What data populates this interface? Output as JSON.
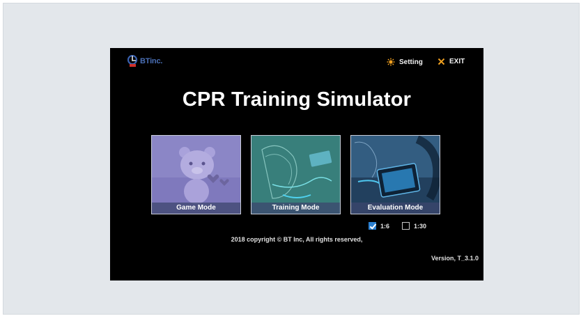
{
  "brand": {
    "logo_text": "BTinc."
  },
  "header": {
    "setting_label": "Setting",
    "exit_label": "EXIT"
  },
  "app_title": "CPR Training Simulator",
  "modes": [
    {
      "label": "Game Mode"
    },
    {
      "label": "Training Mode"
    },
    {
      "label": "Evaluation Mode"
    }
  ],
  "ratio_options": [
    {
      "label": "1:6",
      "checked": true
    },
    {
      "label": "1:30",
      "checked": false
    }
  ],
  "copyright": "2018 copyright © BT Inc, All rights reserved,",
  "version": "Version, T_3.1.0",
  "colors": {
    "accent_orange": "#f0a020",
    "checkbox_blue": "#2a7fd0",
    "game_card": "#8b86c6",
    "training_card": "#3f8a86",
    "evaluation_card": "#3a6a90"
  }
}
